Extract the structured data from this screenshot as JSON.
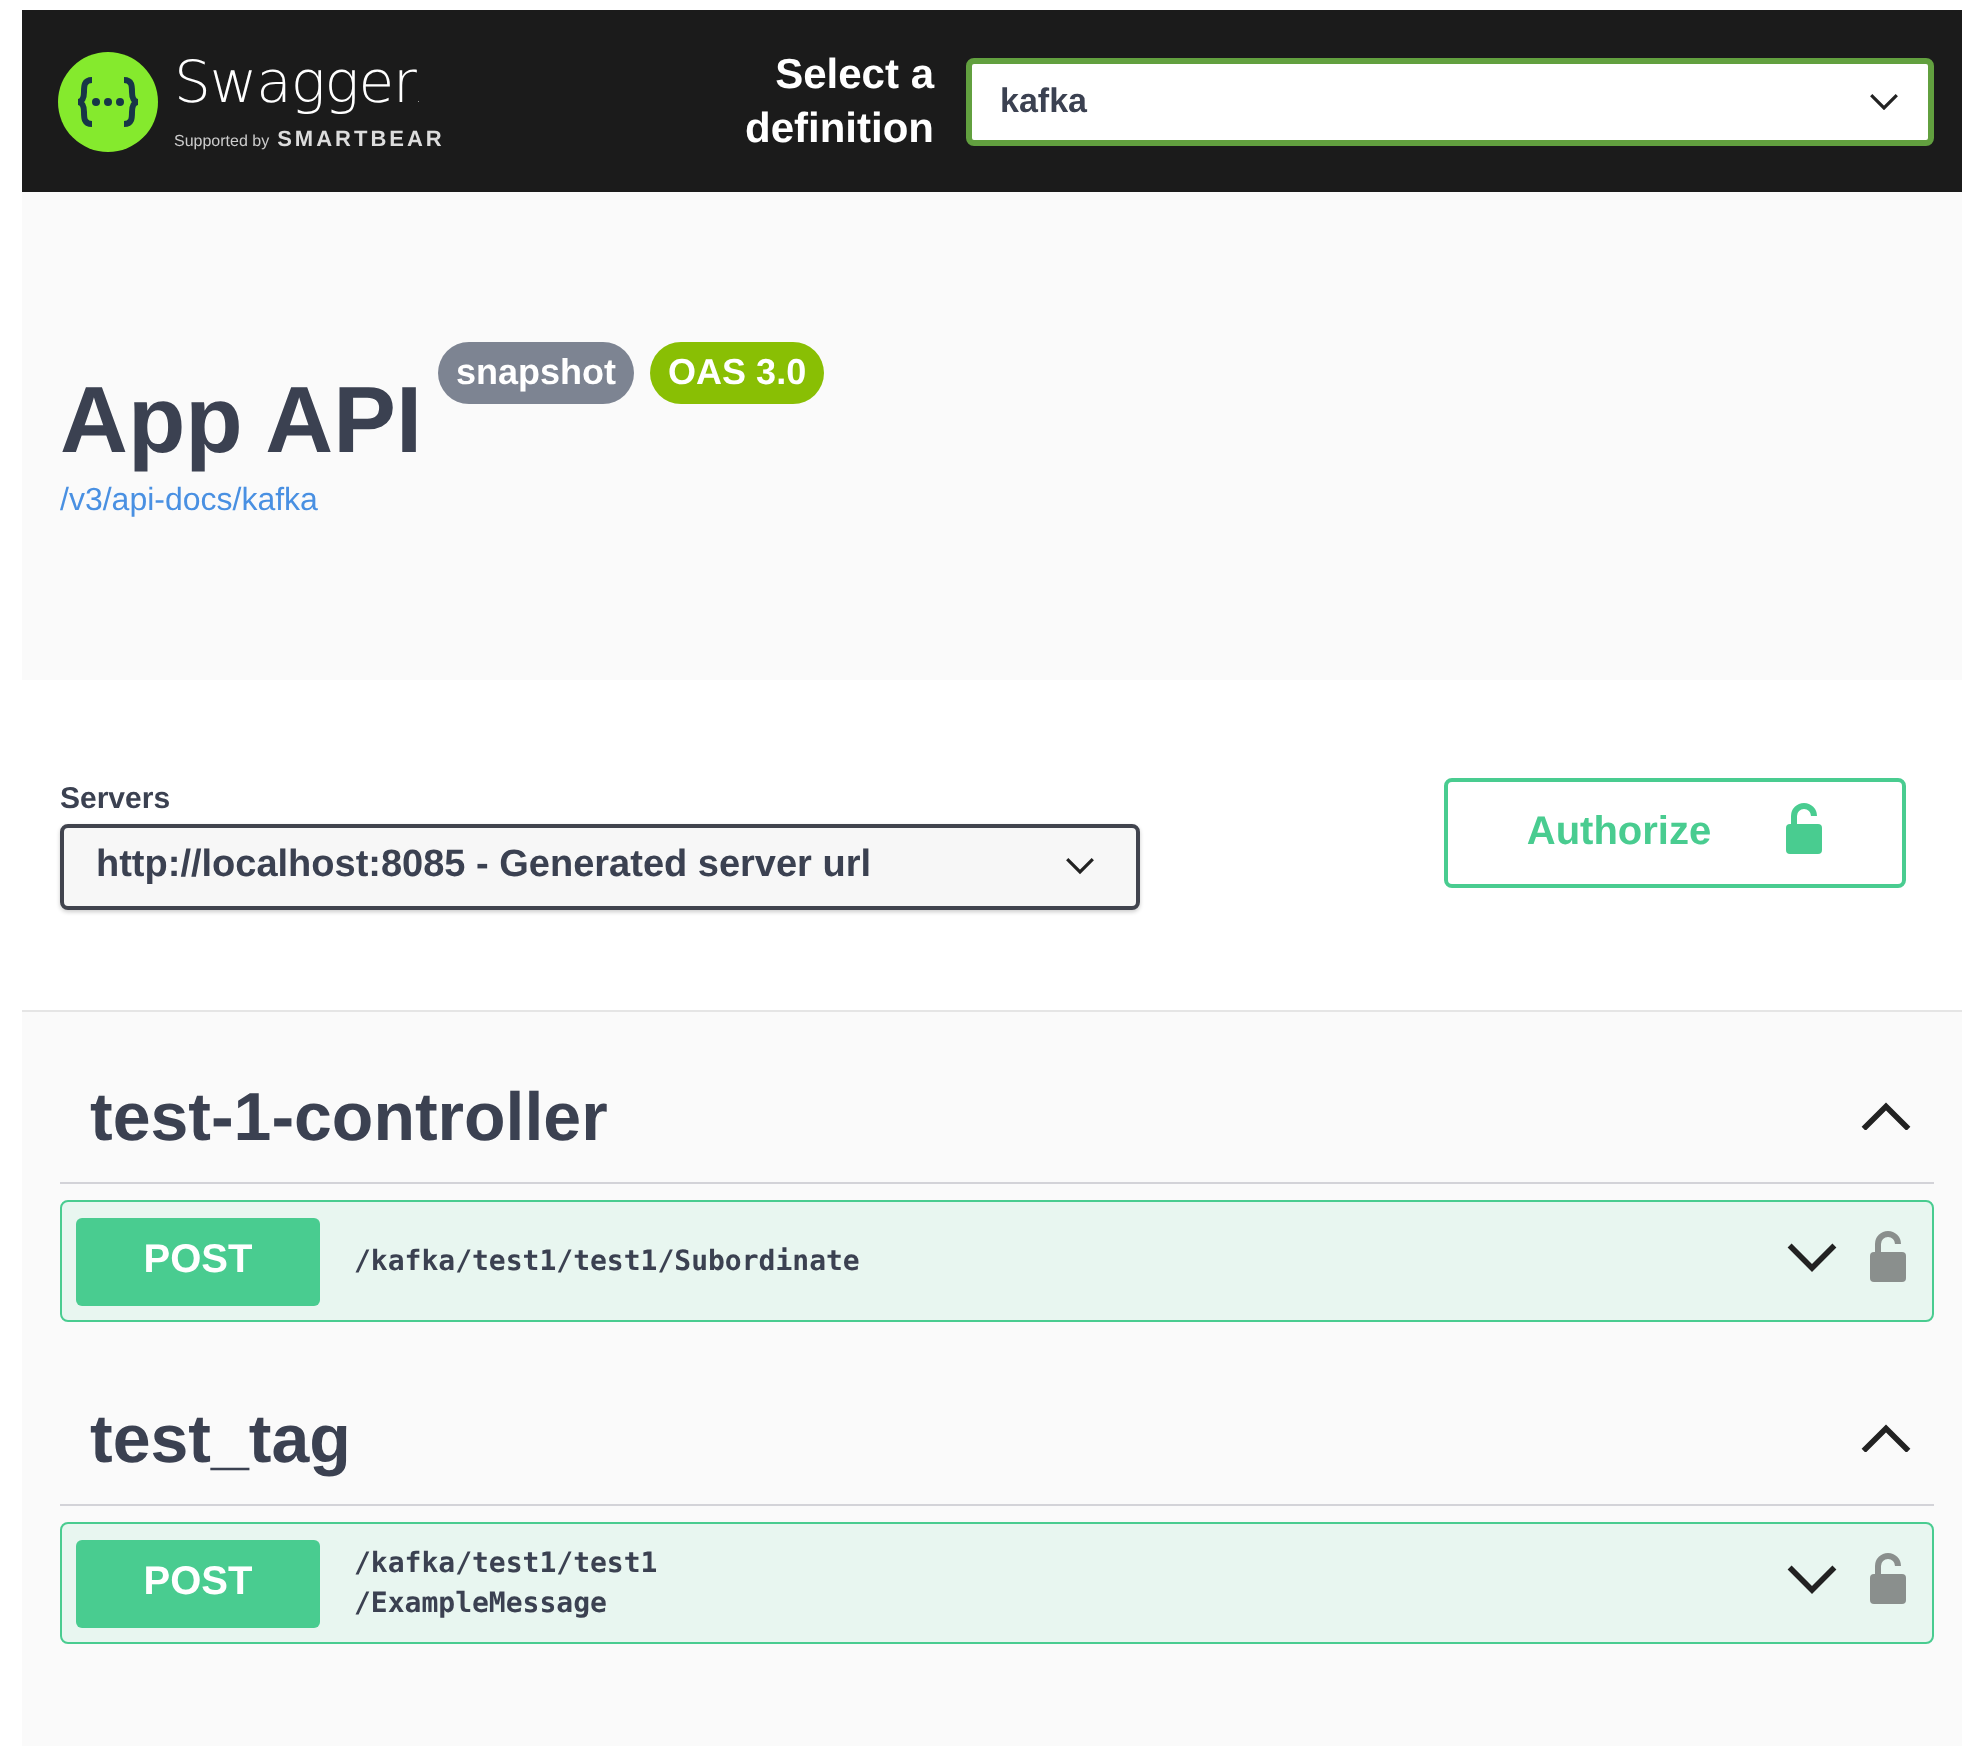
{
  "topbar": {
    "brand": "Swagger",
    "brand_mark": ".",
    "supported_by": "Supported by",
    "company": "SMARTBEAR",
    "definition_label": "Select a\ndefinition",
    "definition_value": "kafka"
  },
  "info": {
    "title": "App API",
    "version": "snapshot",
    "oas": "OAS 3.0",
    "url": "/v3/api-docs/kafka"
  },
  "servers": {
    "label": "Servers",
    "value": "http://localhost:8085 - Generated server url"
  },
  "authorize": {
    "label": "Authorize",
    "locked": false
  },
  "tags": [
    {
      "name": "test-1-controller",
      "expanded": true,
      "operations": [
        {
          "method": "POST",
          "path": "/kafka/test1/test1/Subordinate",
          "expanded": false,
          "locked": false
        }
      ]
    },
    {
      "name": "test_tag",
      "expanded": true,
      "operations": [
        {
          "method": "POST",
          "path": "/kafka/test1/test1\n/ExampleMessage",
          "expanded": false,
          "locked": false
        }
      ]
    }
  ]
}
